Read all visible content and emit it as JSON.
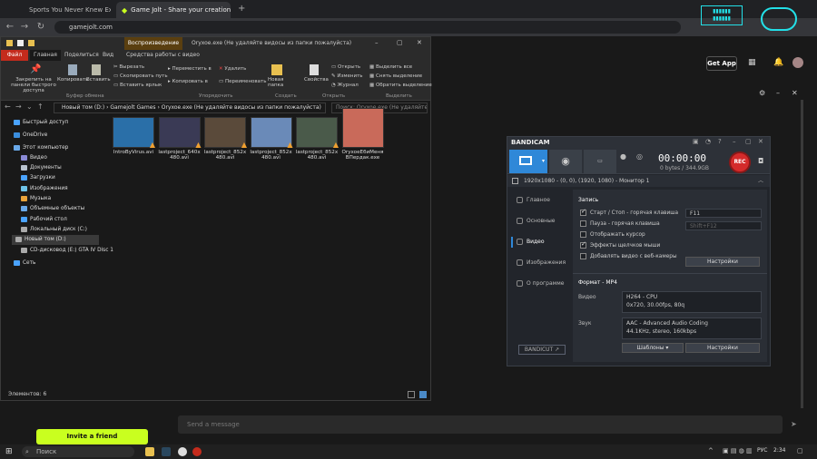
{
  "browser": {
    "tabs": [
      {
        "title": "Sports You Never Knew Existed",
        "active": false
      },
      {
        "title": "Game Jolt - Share your creations",
        "active": true
      }
    ],
    "url": "gamejolt.com"
  },
  "gamejolt": {
    "get_app": "Get App",
    "invite": "Invite a friend",
    "message_placeholder": "Send a message"
  },
  "explorer": {
    "title_tab_play": "Воспроизведение",
    "title_text": "Oryxoe.exe (Не удаляйте видосы из папки пожалуйста)",
    "ribbon_tabs": [
      "Файл",
      "Главная",
      "Поделиться",
      "Вид",
      "Средства работы с видео"
    ],
    "ribbon": {
      "pin": "Закрепить на панели быстрого доступа",
      "copy": "Копировать",
      "paste": "Вставить",
      "cut": "Вырезать",
      "copy_path": "Скопировать путь",
      "paste_shortcut": "Вставить ярлык",
      "move_to": "Переместить в",
      "copy_to": "Копировать в",
      "delete": "Удалить",
      "rename": "Переименовать",
      "new_folder": "Новая папка",
      "properties": "Свойства",
      "open": "Открыть",
      "edit": "Изменить",
      "history": "Журнал",
      "select_all": "Выделить все",
      "select_none": "Снять выделение",
      "invert": "Обратить выделение",
      "group_clipboard": "Буфер обмена",
      "group_organize": "Упорядочить",
      "group_create": "Создать",
      "group_open": "Открыть",
      "group_select": "Выделить"
    },
    "breadcrumb": [
      "Новый том (D:)",
      "Gamejolt Games",
      "Oryxoe.exe (Не удаляйте видосы из папки пожалуйста)"
    ],
    "search_placeholder": "Поиск: Oryxoe.exe (Не удаляйте...",
    "nav": [
      {
        "label": "Быстрый доступ",
        "color": "#4aa3ff",
        "indent": 0
      },
      {
        "label": "OneDrive",
        "color": "#3b8ede",
        "indent": 0
      },
      {
        "label": "Этот компьютер",
        "color": "#6aa9e9",
        "indent": 0
      },
      {
        "label": "Видео",
        "color": "#8b8bd6",
        "indent": 1
      },
      {
        "label": "Документы",
        "color": "#b9c3cf",
        "indent": 1
      },
      {
        "label": "Загрузки",
        "color": "#4aa3ff",
        "indent": 1
      },
      {
        "label": "Изображения",
        "color": "#6ec3e8",
        "indent": 1
      },
      {
        "label": "Музыка",
        "color": "#e8a33b",
        "indent": 1
      },
      {
        "label": "Объемные объекты",
        "color": "#6aa9e9",
        "indent": 1
      },
      {
        "label": "Рабочий стол",
        "color": "#4aa3ff",
        "indent": 1
      },
      {
        "label": "Локальный диск (C:)",
        "color": "#aaaaaa",
        "indent": 1
      },
      {
        "label": "Новый том (D:)",
        "color": "#aaaaaa",
        "indent": 1,
        "selected": true
      },
      {
        "label": "CD-дисковод (E:) GTA IV Disc 1",
        "color": "#aaaaaa",
        "indent": 1
      },
      {
        "label": "Сеть",
        "color": "#4aa3ff",
        "indent": 0
      }
    ],
    "files": [
      {
        "name": "IntroByVirus.avi",
        "color": "#2a6fa8"
      },
      {
        "name": "lastproject_640x480.avi",
        "color": "#3a3a55"
      },
      {
        "name": "lastproject_852x480.avi",
        "color": "#5a4a3a"
      },
      {
        "name": "lastproject_852x480.avi",
        "color": "#6a8ab8"
      },
      {
        "name": "lastproject_852x480.avi",
        "color": "#4a5a4a"
      },
      {
        "name": "OryxoeEбиМеняВПердак.exe",
        "color": "#c96a5a"
      }
    ],
    "status": "Элементов: 6"
  },
  "bandicam": {
    "brand": "BANDICAM",
    "timer": "00:00:00",
    "size": "0 bytes / 344.9GB",
    "rec": "REC",
    "target": "1920x1080 - (0, 0), (1920, 1080) - Монитор 1",
    "sidebar": [
      "Главное",
      "Основные",
      "Видео",
      "Изображения",
      "О программе"
    ],
    "active_side": "Видео",
    "bandicut": "BANDICUT ↗",
    "record_section": "Запись",
    "options": [
      {
        "label": "Старт / Стоп - горячая клавиша",
        "on": true,
        "hotkey": "F11"
      },
      {
        "label": "Пауза - горячая клавиша",
        "on": false,
        "hotkey": "Shift+F12"
      },
      {
        "label": "Отображать курсор",
        "on": false
      },
      {
        "label": "Эффекты щелчков мыши",
        "on": true
      },
      {
        "label": "Добавлять видео с веб-камеры",
        "on": false
      }
    ],
    "settings_btn": "Настройки",
    "format_section": "Формат - MP4",
    "video_label": "Видео",
    "video_value1": "H264 - CPU",
    "video_value2": "0x720, 30.00fps, 80q",
    "audio_label": "Звук",
    "audio_value1": "AAC - Advanced Audio Coding",
    "audio_value2": "44.1KHz, stereo, 160kbps",
    "templates_btn": "Шаблоны",
    "settings_btn2": "Настройки"
  },
  "taskbar": {
    "search": "Поиск",
    "lang": "РУС",
    "time": "2:34"
  },
  "colors": {
    "accent_blue": "#2f88d8",
    "rec_red": "#d42b2b",
    "gamejolt_green": "#c9ff1f",
    "explorer_file_tab": "#c42b1c"
  }
}
